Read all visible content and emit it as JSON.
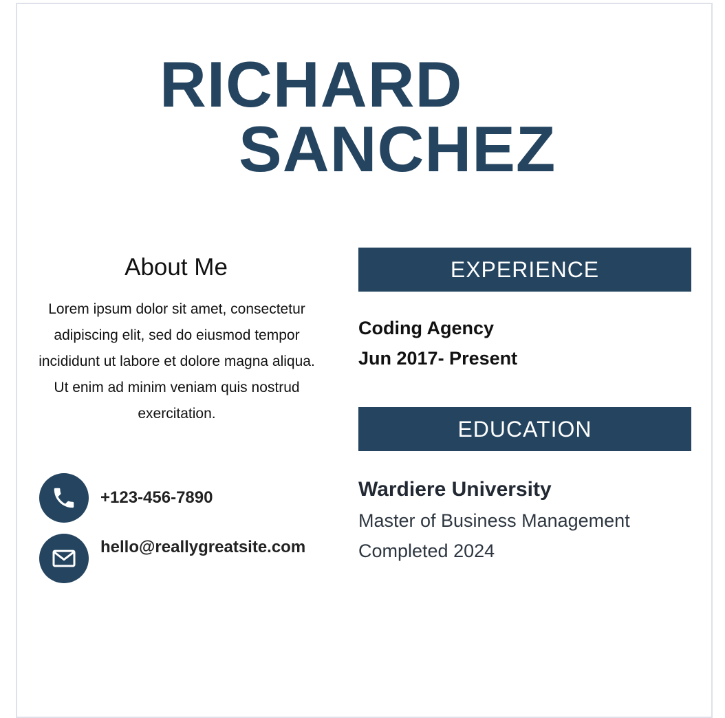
{
  "header": {
    "first_name": "RICHARD",
    "last_name": "SANCHEZ"
  },
  "about": {
    "heading": "About Me",
    "text": "Lorem ipsum dolor sit amet, consectetur adipiscing elit, sed do eiusmod tempor incididunt ut labore et dolore magna aliqua. Ut enim ad minim veniam quis nostrud exercitation."
  },
  "contact": {
    "phone": "+123-456-7890",
    "phone_icon": "phone-icon",
    "email": "hello@reallygreatsite.com",
    "email_icon": "mail-icon"
  },
  "experience": {
    "heading": "EXPERIENCE",
    "company": "Coding Agency",
    "dates": "Jun 2017- Present"
  },
  "education": {
    "heading": "EDUCATION",
    "school": "Wardiere University",
    "degree": "Master of Business Management",
    "completed": "Completed 2024"
  },
  "colors": {
    "accent": "#24445f",
    "border": "#dfe1ea",
    "text": "#111111"
  }
}
